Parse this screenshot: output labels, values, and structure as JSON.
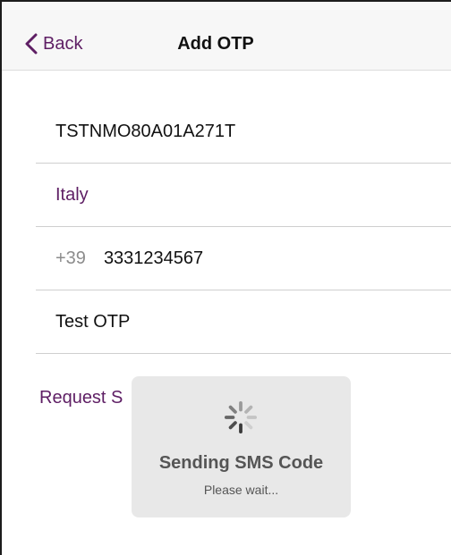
{
  "navbar": {
    "back_label": "Back",
    "title": "Add OTP"
  },
  "form": {
    "code": "TSTNMO80A01A271T",
    "country": "Italy",
    "phone_prefix": "+39",
    "phone_number": "3331234567",
    "name": "Test OTP"
  },
  "request_button_label": "Request S",
  "hud": {
    "title": "Sending SMS Code",
    "subtitle": "Please wait..."
  },
  "colors": {
    "accent": "#5e1e64",
    "text": "#111111",
    "muted": "#8c8c8c"
  },
  "icons": [
    "chevron-left-icon",
    "spinner-icon"
  ]
}
